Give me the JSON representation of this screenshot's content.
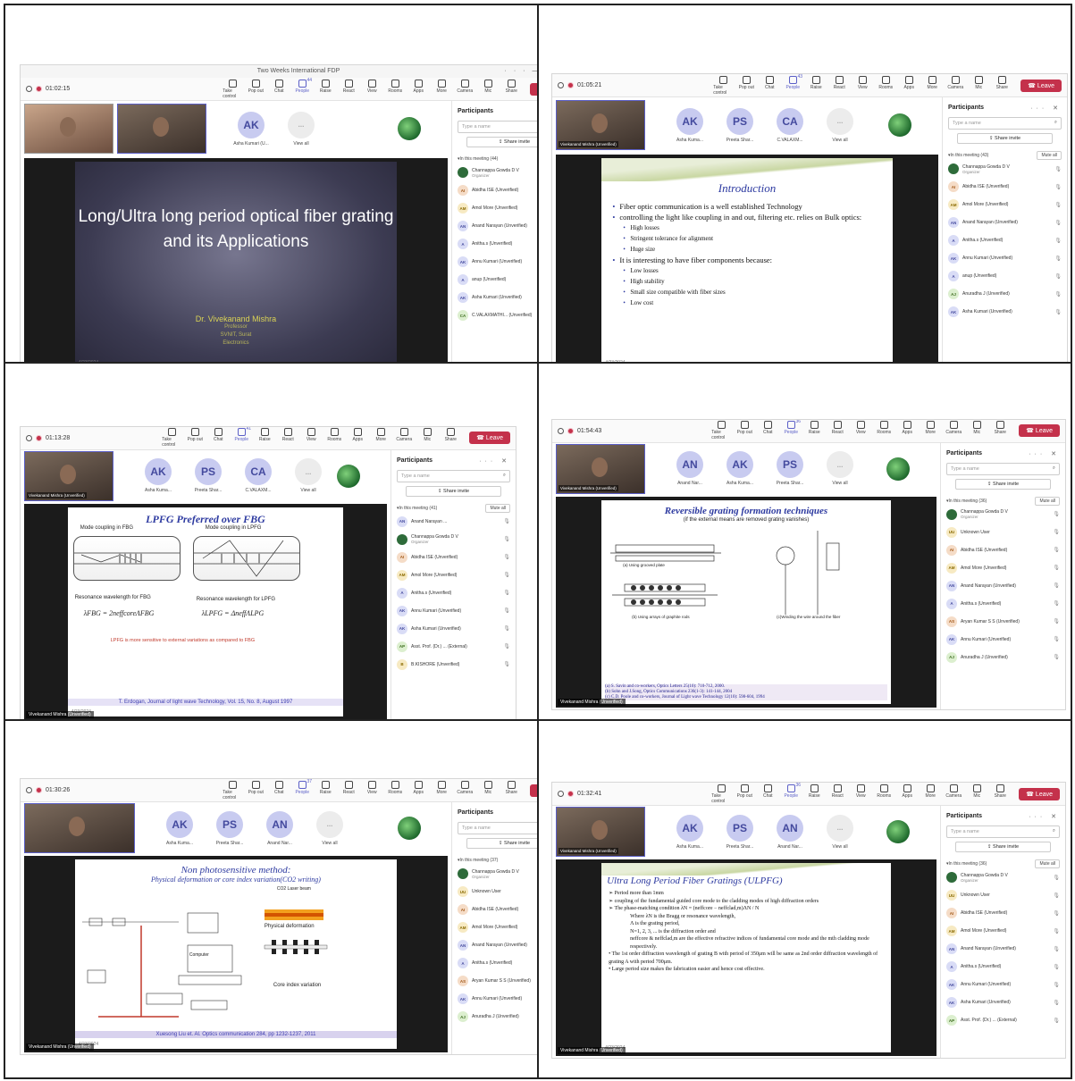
{
  "meeting": {
    "window_title": "Two Weeks International FDP",
    "leave_label": "Leave",
    "toolbar": [
      "Take control",
      "Pop out",
      "Chat",
      "People",
      "Raise",
      "React",
      "View",
      "Rooms",
      "Apps",
      "More",
      "Camera",
      "Mic",
      "Share"
    ],
    "panel_title": "Participants",
    "search_placeholder": "Type a name",
    "share_invite": "Share invite",
    "mute_all": "Mute all",
    "presenter": "Vivekanand Mishra (Unverified)",
    "slide_date": "4/23/2024"
  },
  "panels": [
    {
      "timer": "01:02:15",
      "people_count": "44",
      "in_meeting": "In this meeting (44)",
      "tiles": [
        {
          "initials": "AK",
          "label": "Asha Kumari (U..."
        },
        {
          "initials": "...",
          "label": "View all"
        }
      ],
      "participants": [
        {
          "initials": "",
          "name": "Channappa Gowda D V",
          "sub": "Organizer"
        },
        {
          "initials": "AI",
          "name": "Abidha ISE (Unverified)"
        },
        {
          "initials": "AM",
          "name": "Amol More (Unverified)"
        },
        {
          "initials": "AN",
          "name": "Anand Narayan (Unverified)"
        },
        {
          "initials": "A",
          "name": "Anitha.s (Unverified)"
        },
        {
          "initials": "AK",
          "name": "Annu Kumari (Unverified)"
        },
        {
          "initials": "A",
          "name": "anup (Unverified)"
        },
        {
          "initials": "AK",
          "name": "Asha Kumari (Unverified)"
        },
        {
          "initials": "CA",
          "name": "C.VALAXMATHI... (Unverified)"
        }
      ],
      "slide": {
        "title": "Long/Ultra long period optical fiber grating and its Applications",
        "author": "Dr. Vivekanand Mishra",
        "author_line2": "Professor",
        "author_line3": "SVNIT, Surat",
        "author_line4": "Electronics"
      }
    },
    {
      "timer": "01:05:21",
      "people_count": "43",
      "in_meeting": "In this meeting (43)",
      "tiles": [
        {
          "initials": "AK",
          "label": "Asha Kuma..."
        },
        {
          "initials": "PS",
          "label": "Preeta Shar..."
        },
        {
          "initials": "CA",
          "label": "C.VALAXM..."
        },
        {
          "initials": "...",
          "label": "View all"
        }
      ],
      "participants": [
        {
          "initials": "",
          "name": "Channappa Gowda D V",
          "sub": "Organizer"
        },
        {
          "initials": "AI",
          "name": "Abidha ISE (Unverified)"
        },
        {
          "initials": "AM",
          "name": "Amol More (Unverified)"
        },
        {
          "initials": "AN",
          "name": "Anand Narayan (Unverified)"
        },
        {
          "initials": "A",
          "name": "Anitha.s (Unverified)"
        },
        {
          "initials": "AK",
          "name": "Annu Kumari (Unverified)"
        },
        {
          "initials": "A",
          "name": "anup (Unverified)"
        },
        {
          "initials": "AJ",
          "name": "Anuradha J (Unverified)"
        },
        {
          "initials": "AK",
          "name": "Asha Kumari (Unverified)"
        }
      ],
      "slide": {
        "title": "Introduction",
        "bullets": [
          {
            "text": "Fiber optic communication is a well  established Technology",
            "sub": false
          },
          {
            "text": "controlling the light like coupling in and out, filtering etc. relies on Bulk optics:",
            "sub": false
          },
          {
            "text": "High losses",
            "sub": true
          },
          {
            "text": "Stringent tolerance for alignment",
            "sub": true
          },
          {
            "text": "Huge size",
            "sub": true
          },
          {
            "text": "It is interesting to have fiber components because:",
            "sub": false
          },
          {
            "text": "Low losses",
            "sub": true
          },
          {
            "text": "High stability",
            "sub": true
          },
          {
            "text": "Small size compatible with fiber sizes",
            "sub": true
          },
          {
            "text": "Low cost",
            "sub": true
          }
        ]
      }
    },
    {
      "timer": "01:13:28",
      "people_count": "41",
      "in_meeting": "In this meeting (41)",
      "tiles": [
        {
          "initials": "AK",
          "label": "Asha Kuma..."
        },
        {
          "initials": "PS",
          "label": "Preeta Shar..."
        },
        {
          "initials": "CA",
          "label": "C.VALAXM..."
        },
        {
          "initials": "...",
          "label": "View all"
        }
      ],
      "participants": [
        {
          "initials": "AN",
          "name": "Anand Narayan ..."
        },
        {
          "initials": "",
          "name": "Channappa Gowda D V",
          "sub": "Organizer"
        },
        {
          "initials": "AI",
          "name": "Abidha ISE (Unverified)"
        },
        {
          "initials": "AM",
          "name": "Amol More (Unverified)"
        },
        {
          "initials": "A",
          "name": "Anitha.s (Unverified)"
        },
        {
          "initials": "AK",
          "name": "Annu Kumari (Unverified)"
        },
        {
          "initials": "AK",
          "name": "Asha Kumari (Unverified)"
        },
        {
          "initials": "AP",
          "name": "Asst. Prof. (Dr.) ... (External)"
        },
        {
          "initials": "B",
          "name": "B.KISHORE (Unverified)"
        }
      ],
      "slide": {
        "title": "LPFG Preferred over FBG",
        "left_label": "Mode coupling in FBG",
        "right_label": "Mode coupling in LPFG",
        "res_fbg": "Resonance wavelength for FBG",
        "res_lpfg": "Resonance wavelength for LPFG",
        "eq_fbg": "λFBG = 2neffcoreΛFBG",
        "eq_lpfg": "λLPFG = ΔneffΛLPG",
        "note": "LPFG is more sensitive to external variations as compared to FBG",
        "ref": "T. Erdogan, Journal of light wave Technology, Vol. 15, No. 8, August 1997"
      }
    },
    {
      "timer": "01:54:43",
      "people_count": "36",
      "in_meeting": "In this meeting (36)",
      "tiles": [
        {
          "initials": "AN",
          "label": "Anand Nar..."
        },
        {
          "initials": "AK",
          "label": "Asha Kuma..."
        },
        {
          "initials": "PS",
          "label": "Preeta Shar..."
        },
        {
          "initials": "...",
          "label": "View all"
        }
      ],
      "participants": [
        {
          "initials": "",
          "name": "Channappa Gowda D V",
          "sub": "Organizer"
        },
        {
          "initials": "UU",
          "name": "Unknown User"
        },
        {
          "initials": "AI",
          "name": "Abidha ISE (Unverified)"
        },
        {
          "initials": "AM",
          "name": "Amol More (Unverified)"
        },
        {
          "initials": "AN",
          "name": "Anand Narayan (Unverified)"
        },
        {
          "initials": "A",
          "name": "Anitha.s (Unverified)"
        },
        {
          "initials": "AS",
          "name": "Aryan Kumar S S (Unverified)"
        },
        {
          "initials": "AK",
          "name": "Annu Kumari (Unverified)"
        },
        {
          "initials": "AJ",
          "name": "Anuradha J (Unverified)"
        }
      ],
      "slide": {
        "title": "Reversible grating formation techniques",
        "subtitle": "(if the external means are removed grating vanishes)",
        "cap_a": "(a) Using grooved plate",
        "cap_b": "(b) Using arrays of graphite rods",
        "cap_c": "(c)Winding the wire around the fiber",
        "refs": [
          "(a) S. Savin and co-workers, Optics Letters 25(10): 710-712, 2000.",
          "(b) Sohn and J.Song, Optics Communications 236(1-3): 141-144, 2004",
          "(c) C.D. Poole and co-workers, Journal of Light wave Technology 12(10): 598-604, 1994"
        ]
      }
    },
    {
      "timer": "01:30:26",
      "people_count": "37",
      "in_meeting": "In this meeting (37)",
      "tiles": [
        {
          "initials": "AK",
          "label": "Asha Kuma..."
        },
        {
          "initials": "PS",
          "label": "Preeta Shar..."
        },
        {
          "initials": "AN",
          "label": "Anand Nar..."
        },
        {
          "initials": "...",
          "label": "View all"
        }
      ],
      "participants": [
        {
          "initials": "",
          "name": "Channappa Gowda D V",
          "sub": "Organizer"
        },
        {
          "initials": "UU",
          "name": "Unknown User"
        },
        {
          "initials": "AI",
          "name": "Abidha ISE (Unverified)"
        },
        {
          "initials": "AM",
          "name": "Amol More (Unverified)"
        },
        {
          "initials": "AN",
          "name": "Anand Narayan (Unverified)"
        },
        {
          "initials": "A",
          "name": "Anitha.s (Unverified)"
        },
        {
          "initials": "AS",
          "name": "Aryan Kumar S S (Unverified)"
        },
        {
          "initials": "AK",
          "name": "Annu Kumari (Unverified)"
        },
        {
          "initials": "AJ",
          "name": "Anuradha J (Unverified)"
        }
      ],
      "slide": {
        "title": "Non photosensitive method:",
        "subtitle": "Physical deformation or core index variation(CO2 writing)",
        "label_deform": "Physical deformation",
        "label_core": "Core index variation",
        "label_beam": "CO2 Laser beam",
        "label_computer": "Computer",
        "ref": "Xuesong Liu et. Al. Optics communication 284, pp 1232-1237, 2011"
      }
    },
    {
      "timer": "01:32:41",
      "people_count": "36",
      "in_meeting": "In this meeting (36)",
      "tiles": [
        {
          "initials": "AK",
          "label": "Asha Kuma..."
        },
        {
          "initials": "PS",
          "label": "Preeta Shar..."
        },
        {
          "initials": "AN",
          "label": "Anand Nar..."
        },
        {
          "initials": "...",
          "label": "View all"
        }
      ],
      "participants": [
        {
          "initials": "",
          "name": "Channappa Gowda D V",
          "sub": "Organizer"
        },
        {
          "initials": "UU",
          "name": "Unknown User"
        },
        {
          "initials": "AI",
          "name": "Abidha ISE (Unverified)"
        },
        {
          "initials": "AM",
          "name": "Amol More (Unverified)"
        },
        {
          "initials": "AN",
          "name": "Anand Narayan (Unverified)"
        },
        {
          "initials": "A",
          "name": "Anitha.s (Unverified)"
        },
        {
          "initials": "AK",
          "name": "Annu Kumari (Unverified)"
        },
        {
          "initials": "AK",
          "name": "Asha Kumari (Unverified)"
        },
        {
          "initials": "AP",
          "name": "Asst. Prof. (Dr.) ... (External)"
        }
      ],
      "slide": {
        "title": "Ultra Long Period Fiber Gratings (ULPFG)",
        "lines": [
          "➢ Period more than 1mm",
          "➢ coupling of the fundamental guided core mode to the cladding modes of high diffraction orders",
          "➢ The phase-matching condition λN = (neffcore − neffclad,m)ΛN / N",
          "Where λN is the Bragg or resonance wavelength,",
          "Λ is the grating period,",
          "N=1, 2, 3, ... is the diffraction order and",
          "neffcore & neffclad,m are the effective refractive indices of fundamental core mode and the mth cladding mode respectively.",
          "• The 1st order diffraction wavelength of grating B with period of 350μm will be same as 2nd order diffraction wavelength of grating A with period 700μm.",
          "• Large period size makes the fabrication easier and hence cost effective."
        ]
      }
    }
  ]
}
